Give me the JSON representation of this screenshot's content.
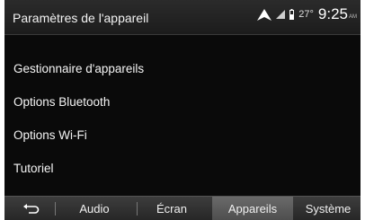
{
  "header": {
    "title": "Paramètres de l'appareil",
    "temperature": "27°",
    "time": "9:25",
    "ampm": "AM"
  },
  "menu": {
    "items": [
      {
        "label": "Gestionnaire d'appareils"
      },
      {
        "label": "Options Bluetooth"
      },
      {
        "label": "Options Wi-Fi"
      },
      {
        "label": "Tutoriel"
      }
    ]
  },
  "tabbar": {
    "tabs": [
      {
        "label": "Audio"
      },
      {
        "label": "Écran"
      },
      {
        "label": "Appareils",
        "active": true
      },
      {
        "label": "Système"
      }
    ]
  },
  "icons": {
    "back": "back-arrow-icon",
    "navigation": "navigation-arrow-icon",
    "signal": "signal-strength-icon",
    "battery": "battery-icon"
  },
  "colors": {
    "background": "#0a0a0a",
    "header": "#242424",
    "active_tab": "#5a5a5a",
    "text": "#ffffff"
  }
}
